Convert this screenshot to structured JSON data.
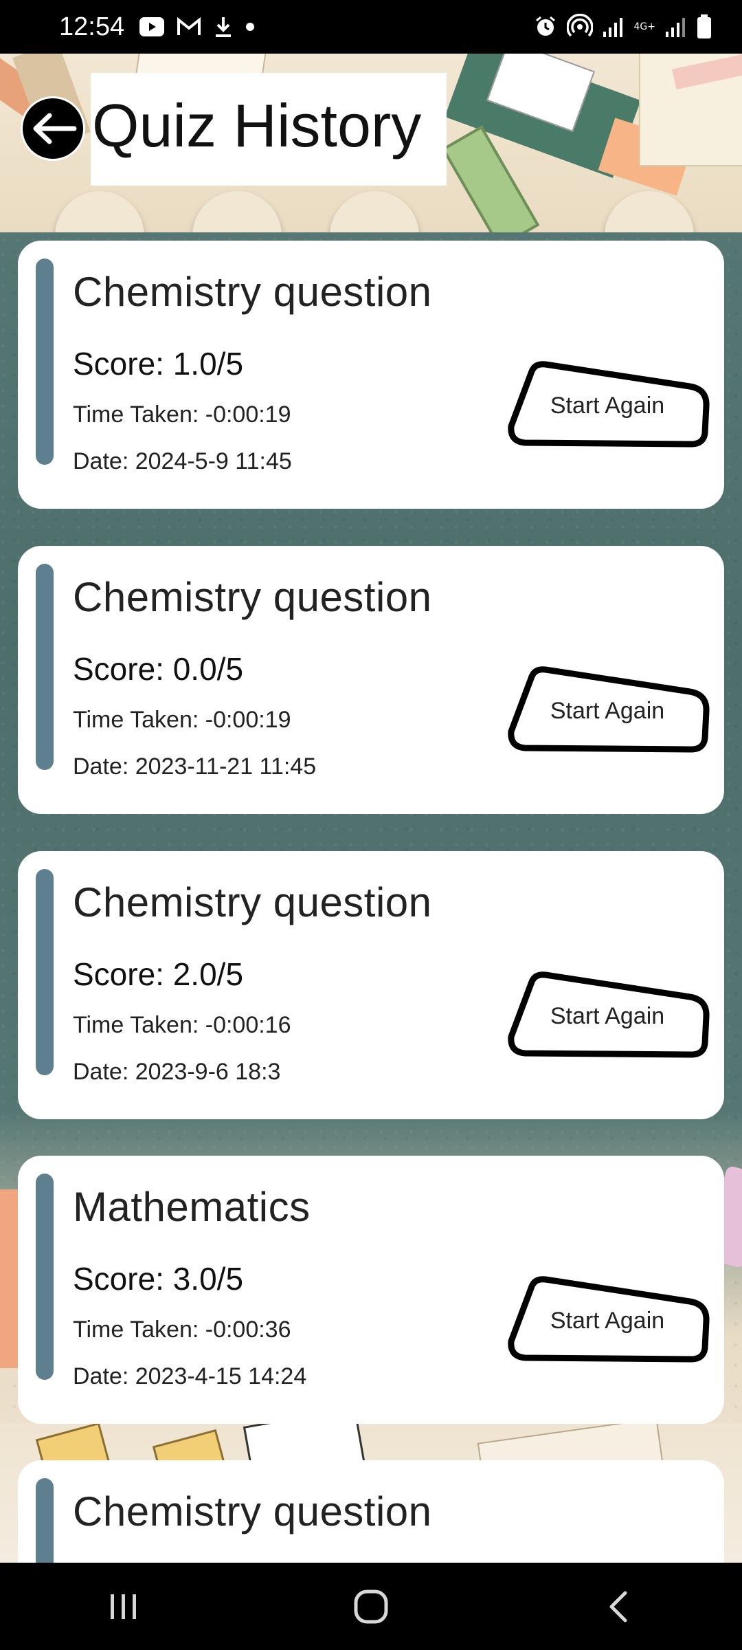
{
  "status_bar": {
    "time": "12:54",
    "left_icons": [
      "youtube-icon",
      "gmail-icon",
      "download-icon",
      "dot-icon"
    ],
    "right_icons": [
      "alarm-icon",
      "hotspot-icon",
      "signal-icon",
      "network-4g-icon",
      "signal-icon-2",
      "battery-icon"
    ],
    "network_label": "4G+"
  },
  "header": {
    "title": "Quiz History",
    "back_icon": "arrow-left-icon"
  },
  "quizzes": [
    {
      "subject": "Chemistry question",
      "score": "Score: 1.0/5",
      "time_taken": "Time Taken: -0:00:19",
      "date": "Date: 2024-5-9 11:45",
      "button": "Start Again"
    },
    {
      "subject": "Chemistry question",
      "score": "Score: 0.0/5",
      "time_taken": "Time Taken: -0:00:19",
      "date": "Date: 2023-11-21 11:45",
      "button": "Start Again"
    },
    {
      "subject": "Chemistry question",
      "score": "Score: 2.0/5",
      "time_taken": "Time Taken: -0:00:16",
      "date": "Date: 2023-9-6 18:3",
      "button": "Start Again"
    },
    {
      "subject": "Mathematics",
      "score": "Score: 3.0/5",
      "time_taken": "Time Taken: -0:00:36",
      "date": "Date: 2023-4-15 14:24",
      "button": "Start Again"
    },
    {
      "subject": "Chemistry question"
    }
  ],
  "nav_bar": {
    "recents_icon": "recents-icon",
    "home_icon": "home-icon",
    "back_icon": "back-icon"
  },
  "colors": {
    "accent_bar": "#5e7f8e",
    "background": "#4e6f6d",
    "card": "#ffffff"
  }
}
